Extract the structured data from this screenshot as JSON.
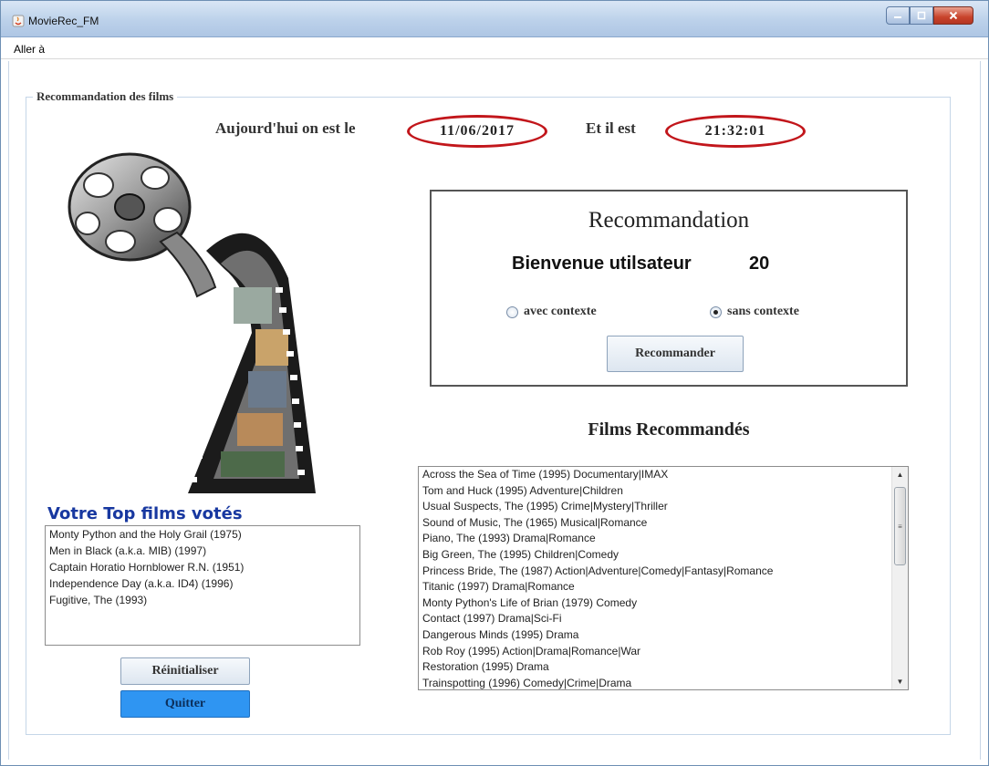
{
  "window": {
    "title": "MovieRec_FM",
    "menu": [
      "Aller à"
    ]
  },
  "panel": {
    "legend": "Recommandation des films",
    "date_label": "Aujourd'hui on est le",
    "date_value": "11/06/2017",
    "time_label": "Et il est",
    "time_value": "21:32:01"
  },
  "recommendation": {
    "title": "Recommandation",
    "welcome": "Bienvenue utilsateur",
    "user_id": "20",
    "options": [
      {
        "label": "avec contexte",
        "selected": false
      },
      {
        "label": "sans contexte",
        "selected": true
      }
    ],
    "button": "Recommander"
  },
  "recommended_films": {
    "title": "Films Recommandés",
    "items": [
      "Across the Sea of Time (1995) Documentary|IMAX",
      "Tom and Huck (1995) Adventure|Children",
      "Usual Suspects, The (1995) Crime|Mystery|Thriller",
      "Sound of Music, The (1965) Musical|Romance",
      "Piano, The (1993) Drama|Romance",
      "Big Green, The (1995) Children|Comedy",
      "Princess Bride, The (1987) Action|Adventure|Comedy|Fantasy|Romance",
      "Titanic (1997) Drama|Romance",
      "Monty Python's Life of Brian (1979) Comedy",
      "Contact (1997) Drama|Sci-Fi",
      "Dangerous Minds (1995) Drama",
      "Rob Roy (1995) Action|Drama|Romance|War",
      "Restoration (1995) Drama",
      "Trainspotting (1996) Comedy|Crime|Drama"
    ]
  },
  "top_films": {
    "title": "Votre Top films votés",
    "items": [
      "Monty Python and the Holy Grail (1975)",
      "Men in Black (a.k.a. MIB) (1997)",
      "Captain Horatio Hornblower R.N. (1951)",
      "Independence Day (a.k.a. ID4) (1996)",
      "Fugitive, The (1993)"
    ]
  },
  "buttons": {
    "reset": "Réinitialiser",
    "quit": "Quitter"
  },
  "colors": {
    "date_ellipse": "#c2161b",
    "top_title": "#1838a0",
    "quit_button": "#2f95f2"
  }
}
